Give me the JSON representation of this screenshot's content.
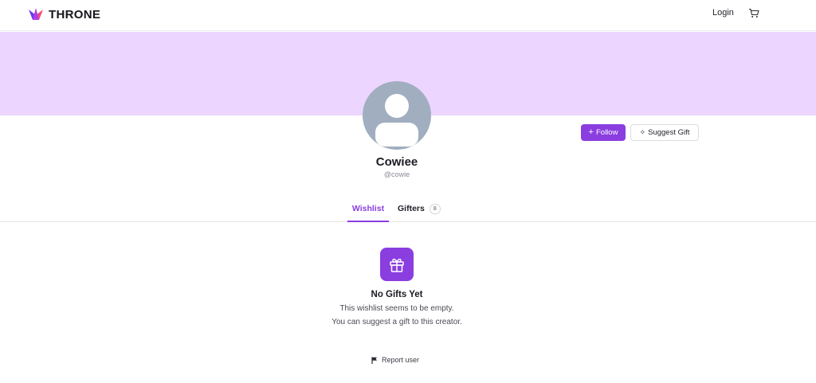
{
  "header": {
    "brand": "THRONE",
    "login_label": "Login",
    "icons": {
      "logo": "throne-crown-logo",
      "cart": "cart-icon"
    }
  },
  "colors": {
    "accent": "#8a3ee0",
    "banner": "#ecd5fe",
    "avatar_bg": "#a0aec0"
  },
  "profile": {
    "name": "Cowiee",
    "handle": "@cowie",
    "follow_label": "Follow",
    "suggest_label": "Suggest Gift"
  },
  "tabs": [
    {
      "label": "Wishlist",
      "active": true
    },
    {
      "label": "Gifters",
      "count": "8",
      "active": false
    }
  ],
  "empty_state": {
    "icon": "gift-icon",
    "title": "No Gifts Yet",
    "line1": "This wishlist seems to be empty.",
    "line2": "You can suggest a gift to this creator."
  },
  "footer": {
    "report_label": "Report user",
    "report_icon": "flag-icon"
  }
}
